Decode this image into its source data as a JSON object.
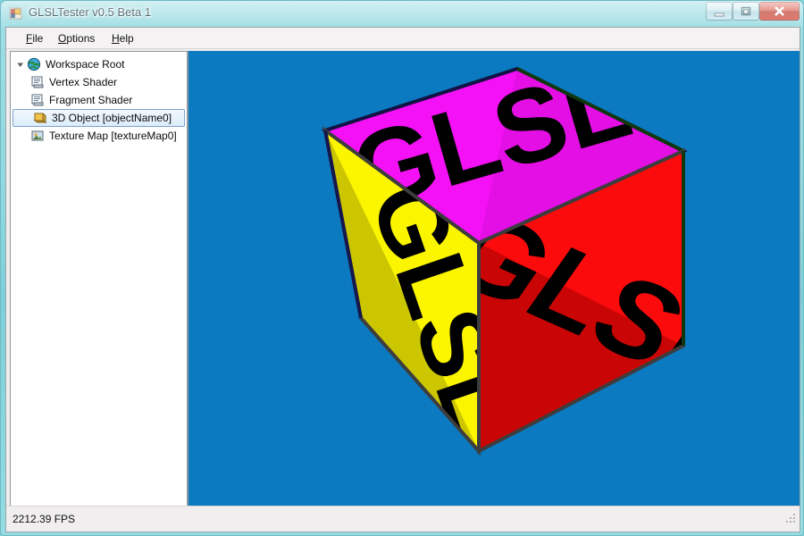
{
  "window": {
    "title": "GLSLTester v0.5 Beta 1",
    "app_icon": "application-icon",
    "controls": {
      "minimize_label": "Minimize",
      "maximize_label": "Maximize",
      "close_label": "Close"
    }
  },
  "menu": {
    "items": [
      {
        "label": "File",
        "accesskey": "F",
        "rest": "ile"
      },
      {
        "label": "Options",
        "accesskey": "O",
        "rest": "ptions"
      },
      {
        "label": "Help",
        "accesskey": "H",
        "rest": "elp"
      }
    ]
  },
  "tree": {
    "items": [
      {
        "label": "Workspace Root",
        "icon": "globe-icon",
        "level": 0,
        "expanded": true,
        "selected": false
      },
      {
        "label": "Vertex Shader",
        "icon": "shader-document-icon",
        "level": 1,
        "selected": false
      },
      {
        "label": "Fragment Shader",
        "icon": "shader-document-icon",
        "level": 1,
        "selected": false
      },
      {
        "label": "3D Object [objectName0]",
        "icon": "cube-icon",
        "level": 1,
        "selected": true
      },
      {
        "label": "Texture Map [textureMap0]",
        "icon": "image-icon",
        "level": 1,
        "selected": false
      }
    ]
  },
  "viewport": {
    "background_color": "#0b7ac0",
    "render_label": "3d-cube-render",
    "cube": {
      "face_text": "GLSL",
      "faces": [
        {
          "name": "top",
          "color": "#f511f5",
          "shade_color": "#e40fe4"
        },
        {
          "name": "left",
          "color": "#fcf500",
          "shade_color": "#cbc600"
        },
        {
          "name": "right",
          "color": "#fb0b0b",
          "shade_color": "#c90505"
        }
      ],
      "edge_colors": [
        "#121244",
        "#10380f",
        "#4a4a4a"
      ]
    }
  },
  "status": {
    "fps_text": "2212.39 FPS"
  }
}
